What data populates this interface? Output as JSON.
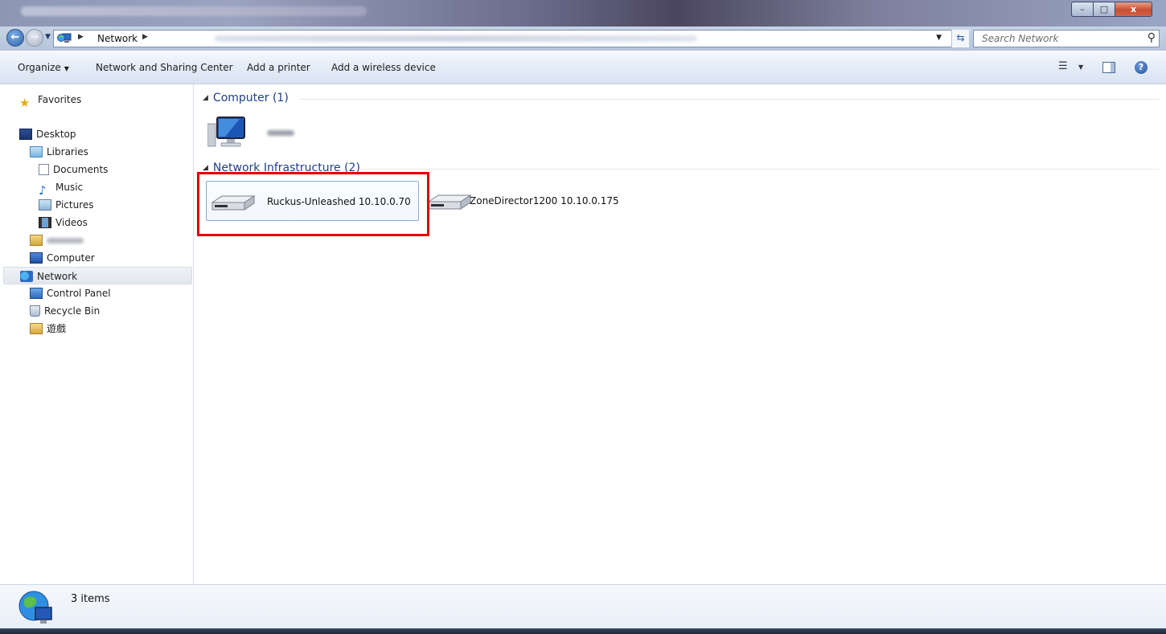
{
  "window": {
    "title": "",
    "controls": {
      "minimize": "–",
      "maximize": "□",
      "close": "x"
    }
  },
  "address_bar": {
    "breadcrumb": [
      "Network"
    ],
    "search_placeholder": "Search Network"
  },
  "command_bar": {
    "items": [
      "Organize",
      "Network and Sharing Center",
      "Add a printer",
      "Add a wireless device"
    ]
  },
  "nav_pane": {
    "favorites": "Favorites",
    "desktop": "Desktop",
    "libraries": "Libraries",
    "documents": "Documents",
    "music": "Music",
    "pictures": "Pictures",
    "videos": "Videos",
    "user_files": "",
    "computer": "Computer",
    "network": "Network",
    "control_panel": "Control Panel",
    "recycle_bin": "Recycle Bin",
    "games": "遊戲"
  },
  "content": {
    "groups": [
      {
        "title": "Computer (1)",
        "items": [
          {
            "name": ""
          }
        ]
      },
      {
        "title": "Network Infrastructure (2)",
        "items": [
          {
            "name": "Ruckus-Unleashed 10.10.0.70",
            "selected": true
          },
          {
            "name": "ZoneDirector1200 10.10.0.175",
            "selected": false
          }
        ]
      }
    ]
  },
  "details_pane": {
    "item_count": "3 items"
  },
  "colors": {
    "highlight_box": "#e00000",
    "group_header": "#1e3f8a",
    "selection_border": "#84acdd"
  }
}
